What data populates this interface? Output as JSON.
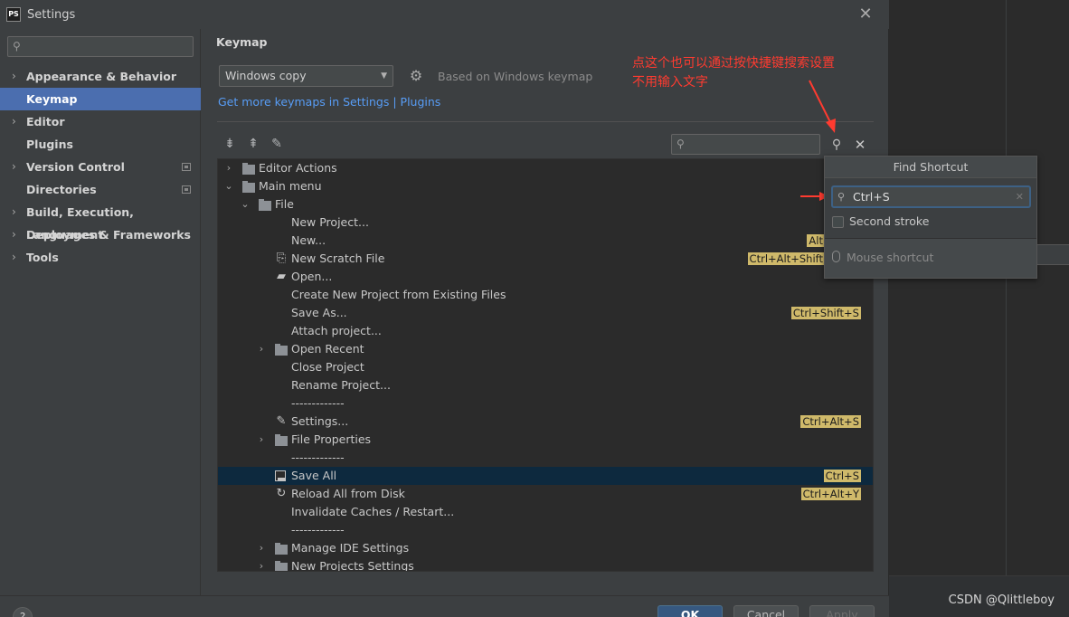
{
  "window": {
    "title": "Settings",
    "app_icon_label": "PS"
  },
  "sidebar": {
    "items": [
      {
        "label": "Appearance & Behavior",
        "chevron": true,
        "badge": false
      },
      {
        "label": "Keymap",
        "chevron": false,
        "badge": false
      },
      {
        "label": "Editor",
        "chevron": true,
        "badge": false
      },
      {
        "label": "Plugins",
        "chevron": false,
        "badge": false
      },
      {
        "label": "Version Control",
        "chevron": true,
        "badge": true
      },
      {
        "label": "Directories",
        "chevron": false,
        "badge": true
      },
      {
        "label": "Build, Execution, Deployment",
        "chevron": true,
        "badge": false
      },
      {
        "label": "Languages & Frameworks",
        "chevron": true,
        "badge": false
      },
      {
        "label": "Tools",
        "chevron": true,
        "badge": false
      }
    ],
    "selected": "Keymap"
  },
  "keymap": {
    "title": "Keymap",
    "selected_scheme": "Windows copy",
    "based_on": "Based on Windows keymap",
    "more_link": "Get more keymaps in Settings | Plugins"
  },
  "annotation": {
    "line1": "点这个也可以通过按快捷键搜索设置",
    "line2": "不用输入文字",
    "color": "#ff3b30"
  },
  "tree": {
    "rows": [
      {
        "label": "Editor Actions",
        "indent": 0,
        "chevron": ">",
        "icon": "folder",
        "shortcut": ""
      },
      {
        "label": "Main menu",
        "indent": 0,
        "chevron": "v",
        "icon": "folder",
        "shortcut": ""
      },
      {
        "label": "File",
        "indent": 1,
        "chevron": "v",
        "icon": "folder",
        "shortcut": ""
      },
      {
        "label": "New Project...",
        "indent": 2,
        "chevron": "",
        "icon": "",
        "shortcut": ""
      },
      {
        "label": "New...",
        "indent": 2,
        "chevron": "",
        "icon": "",
        "shortcut": "Alt"
      },
      {
        "label": "New Scratch File",
        "indent": 2,
        "chevron": "",
        "icon": "scratch",
        "shortcut": "Ctrl+Alt+Shift"
      },
      {
        "label": "Open...",
        "indent": 2,
        "chevron": "",
        "icon": "open-folder",
        "shortcut": ""
      },
      {
        "label": "Create New Project from Existing Files",
        "indent": 2,
        "chevron": "",
        "icon": "",
        "shortcut": ""
      },
      {
        "label": "Save As...",
        "indent": 2,
        "chevron": "",
        "icon": "",
        "shortcut": "Ctrl+Shift+S"
      },
      {
        "label": "Attach project...",
        "indent": 2,
        "chevron": "",
        "icon": "",
        "shortcut": ""
      },
      {
        "label": "Open Recent",
        "indent": 2,
        "chevron": ">",
        "icon": "folder",
        "shortcut": ""
      },
      {
        "label": "Close Project",
        "indent": 2,
        "chevron": "",
        "icon": "",
        "shortcut": ""
      },
      {
        "label": "Rename Project...",
        "indent": 2,
        "chevron": "",
        "icon": "",
        "shortcut": ""
      },
      {
        "label": "-------------",
        "indent": 2,
        "chevron": "",
        "icon": "",
        "shortcut": ""
      },
      {
        "label": "Settings...",
        "indent": 2,
        "chevron": "",
        "icon": "wrench",
        "shortcut": "Ctrl+Alt+S"
      },
      {
        "label": "File Properties",
        "indent": 2,
        "chevron": ">",
        "icon": "folder",
        "shortcut": ""
      },
      {
        "label": "-------------",
        "indent": 2,
        "chevron": "",
        "icon": "",
        "shortcut": ""
      },
      {
        "label": "Save All",
        "indent": 2,
        "chevron": "",
        "icon": "save",
        "shortcut": "Ctrl+S",
        "selected": true
      },
      {
        "label": "Reload All from Disk",
        "indent": 2,
        "chevron": "",
        "icon": "reload",
        "shortcut": "Ctrl+Alt+Y"
      },
      {
        "label": "Invalidate Caches / Restart...",
        "indent": 2,
        "chevron": "",
        "icon": "",
        "shortcut": ""
      },
      {
        "label": "-------------",
        "indent": 2,
        "chevron": "",
        "icon": "",
        "shortcut": ""
      },
      {
        "label": "Manage IDE Settings",
        "indent": 2,
        "chevron": ">",
        "icon": "folder",
        "shortcut": ""
      },
      {
        "label": "New Projects Settings",
        "indent": 2,
        "chevron": ">",
        "icon": "folder",
        "shortcut": ""
      }
    ]
  },
  "find_shortcut": {
    "title": "Find Shortcut",
    "value": "Ctrl+S",
    "second_stroke_label": "Second stroke",
    "second_stroke_checked": false,
    "mouse_shortcut_label": "Mouse shortcut"
  },
  "buttons": {
    "help": "?",
    "ok": "OK",
    "cancel": "Cancel",
    "apply": "Apply"
  },
  "watermark": "CSDN @Qlittleboy"
}
